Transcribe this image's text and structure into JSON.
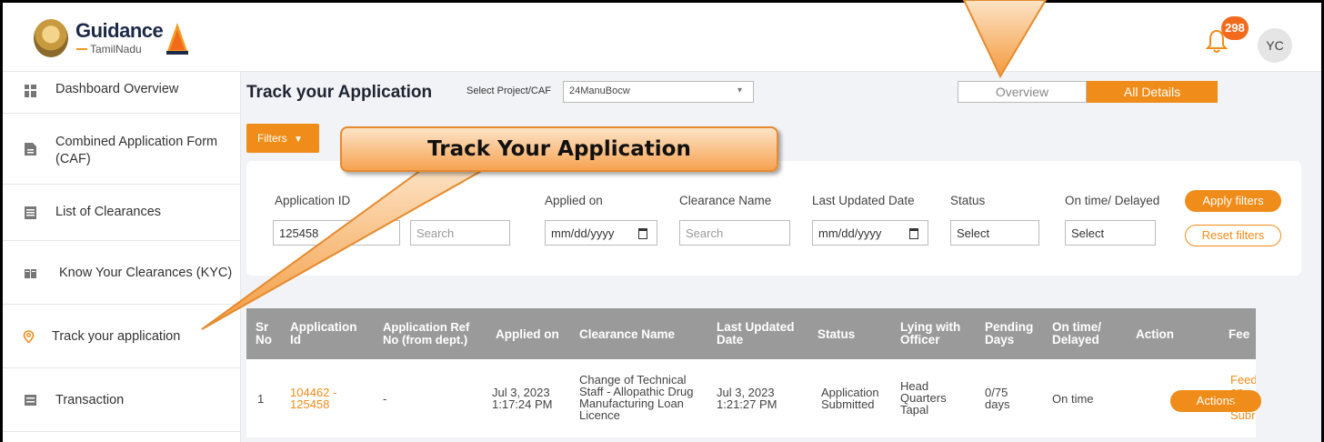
{
  "header": {
    "logo_text": "Guidance",
    "logo_sub": "TamilNadu",
    "notification_count": "298",
    "avatar_initials": "YC"
  },
  "sidebar": {
    "items": [
      {
        "label": "Dashboard Overview",
        "icon": "grid-icon"
      },
      {
        "label": "Combined Application Form (CAF)",
        "icon": "document-icon"
      },
      {
        "label": "List of Clearances",
        "icon": "list-icon"
      },
      {
        "label": "Know Your Clearances (KYC)",
        "icon": "book-icon"
      },
      {
        "label": "Track your application",
        "icon": "location-pin-icon"
      },
      {
        "label": "Transaction",
        "icon": "transaction-icon"
      }
    ]
  },
  "main": {
    "title": "Track your Application",
    "select_label": "Select Project/CAF",
    "select_value": "24ManuBocw",
    "toggle": {
      "overview": "Overview",
      "all_details": "All Details"
    },
    "filters_button": "Filters",
    "filters": {
      "application_id_label": "Application ID",
      "application_id_value": "125458",
      "ref_placeholder": "Search",
      "applied_on_label": "Applied on",
      "applied_on_value": "mm/dd/yyyy",
      "clearance_name_label": "Clearance Name",
      "clearance_name_placeholder": "Search",
      "last_updated_label": "Last Updated Date",
      "last_updated_value": "mm/dd/yyyy",
      "status_label": "Status",
      "status_value": "Select",
      "ontime_label": "On time/ Delayed",
      "ontime_value": "Select",
      "apply_button": "Apply filters",
      "reset_button": "Reset filters"
    },
    "table": {
      "headers": [
        "Sr No",
        "Application Id",
        "Application Ref No (from dept.)",
        "Applied on",
        "Clearance Name",
        "Last Updated Date",
        "Status",
        "Lying with Officer",
        "Pending Days",
        "On time/ Delayed",
        "Action",
        "Fee"
      ],
      "rows": [
        {
          "sr": "1",
          "app_id": "104462 - 125458",
          "ref_no": "-",
          "applied_on": "Jul 3, 2023 1:17:24 PM",
          "clearance_name": "Change of Technical Staff - Allopathic Drug Manufacturing Loan Licence",
          "last_updated": "Jul 3, 2023 1:21:27 PM",
          "status": "Application Submitted",
          "officer": "Head Quarters Tapal",
          "pending_days": "0/75 days",
          "ontime": "On time",
          "action_button": "Actions",
          "feedback": "Feed on Appl Subr"
        }
      ]
    }
  },
  "callout": {
    "text": "Track Your Application"
  },
  "colors": {
    "accent": "#f08c19",
    "header_gray": "#9a9a9a",
    "badge": "#f26b1d"
  }
}
